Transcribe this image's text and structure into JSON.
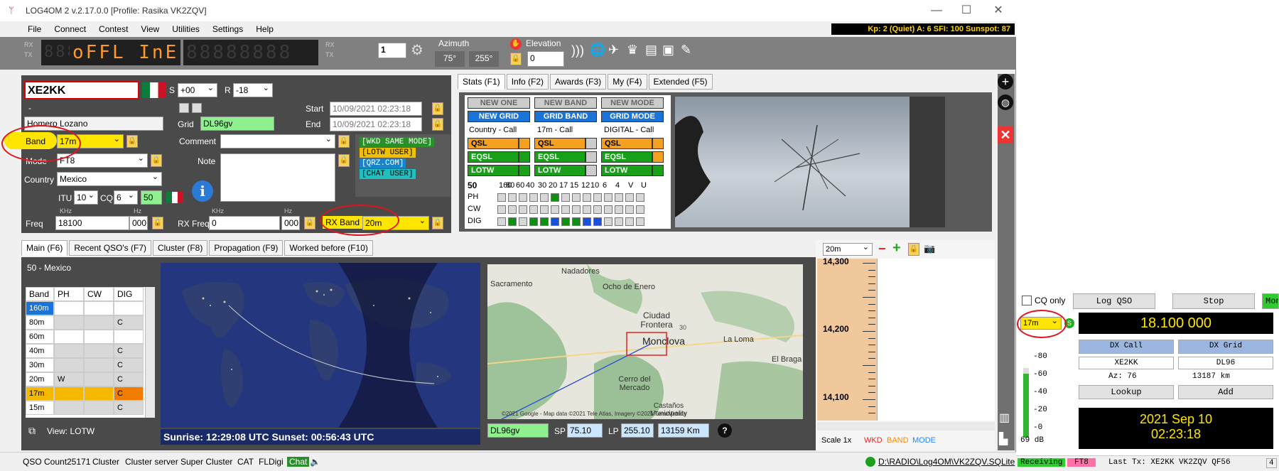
{
  "window": {
    "title": "LOG4OM 2 v.2.17.0.0 [Profile: Rasika VK2ZQV]",
    "minimize": "—",
    "maximize": "☐",
    "close": "✕"
  },
  "menu": [
    "File",
    "Connect",
    "Contest",
    "View",
    "Utilities",
    "Settings",
    "Help"
  ],
  "solar": "Kp: 2 (Quiet)  A: 6  SFI: 100 Sunspot: 87",
  "toolbar": {
    "rx_label": "RX",
    "tx_label": "TX",
    "rx2_label": "RX",
    "tx2_label": "TX",
    "display1": "88888",
    "display_main": "oFFL InE",
    "display2": "88888888",
    "radio_num": "1",
    "azimuth_label": "Azimuth",
    "azimuth_sp": "75°",
    "azimuth_lp": "255°",
    "elevation_label": "Elevation",
    "elevation_value": "0"
  },
  "qso": {
    "callsign": "XE2KK",
    "s_label": "S",
    "s_value": "+00",
    "r_label": "R",
    "r_value": "-18",
    "dash": "-",
    "name": "Homero Lozano",
    "grid_label": "Grid",
    "grid": "DL96gv",
    "start_label": "Start",
    "start": "10/09/2021 02:23:18",
    "end_label": "End",
    "end": "10/09/2021 02:23:18",
    "band_label": "Band",
    "band": "17m",
    "comment_label": "Comment",
    "comment": "",
    "mode_label": "Mode",
    "mode": "FT8",
    "note_label": "Note",
    "country_label": "Country",
    "country": "Mexico",
    "itu_label": "ITU",
    "itu": "10",
    "cq_label": "CQ",
    "cq": "6",
    "dxcc": "50",
    "freq_label": "Freq",
    "khz": "KHz",
    "hz": "Hz",
    "freq_khz": "18100",
    "freq_hz": "000",
    "rxfreq_label": "RX Freq",
    "rxfreq_khz": "0",
    "rxfreq_hz": "000",
    "rxband_label": "RX Band",
    "rxband": "20m",
    "tags": [
      "[WKD SAME MODE]",
      "[LOTW USER]",
      "[QRZ.COM]",
      "[CHAT USER]"
    ]
  },
  "stats": {
    "tabs": [
      "Stats (F1)",
      "Info (F2)",
      "Awards (F3)",
      "My (F4)",
      "Extended (F5)"
    ],
    "row1": [
      "NEW ONE",
      "NEW BAND",
      "NEW MODE"
    ],
    "row2": [
      "NEW GRID",
      "GRID BAND",
      "GRID MODE"
    ],
    "captions": [
      "Country - Call",
      "17m - Call",
      "DIGITAL - Call"
    ],
    "qsl": "QSL",
    "eqsl": "EQSL",
    "lotw": "LOTW",
    "dxcc": "50",
    "bands": [
      "160",
      "80",
      "60",
      "40",
      "30",
      "20",
      "17",
      "15",
      "12",
      "10",
      "6",
      "4",
      "V",
      "U"
    ],
    "modes": [
      "PH",
      "CW",
      "DIG"
    ]
  },
  "main_tabs": [
    "Main (F6)",
    "Recent QSO's (F7)",
    "Cluster (F8)",
    "Propagation (F9)",
    "Worked before (F10)"
  ],
  "band_table": {
    "title": "50 - Mexico",
    "headers": [
      "Band",
      "PH",
      "CW",
      "DIG"
    ],
    "rows": [
      [
        "160m",
        "",
        "",
        ""
      ],
      [
        "80m",
        "",
        "",
        "C"
      ],
      [
        "60m",
        "",
        "",
        ""
      ],
      [
        "40m",
        "",
        "",
        "C"
      ],
      [
        "30m",
        "",
        "",
        "C"
      ],
      [
        "20m",
        "W",
        "",
        "C"
      ],
      [
        "17m",
        "",
        "",
        "C"
      ],
      [
        "15m",
        "",
        "",
        "C"
      ]
    ],
    "view_label": "View:  LOTW"
  },
  "sun": "Sunrise: 12:29:08 UTC  Sunset: 00:56:43 UTC",
  "map": {
    "places": [
      "Nadadores",
      "Sacramento",
      "Ocho de Enero",
      "Ciudad Frontera",
      "Monclova",
      "La Loma",
      "El Braga",
      "Cerro del Mercado",
      "Castaños Municipality"
    ],
    "road": "30",
    "copyright": "©2021 Google - Map data ©2021 Tele Atlas, Imagery ©2021 TerraMetrics",
    "grid": "DL96gv",
    "sp_label": "SP",
    "sp": "75.10",
    "lp_label": "LP",
    "lp": "255.10",
    "distance": "13159 Km"
  },
  "bandmap": {
    "band": "20m",
    "ticks": [
      "14,300",
      "14,200",
      "14,100"
    ],
    "scale": "Scale 1x",
    "wkd": "WKD",
    "band_lbl": "BAND",
    "mode_lbl": "MODE"
  },
  "status": [
    "QSO Count",
    "25171",
    "Cluster",
    "Cluster server",
    "Super Cluster",
    "CAT",
    "FLDigi",
    "Chat"
  ],
  "db_path": "D:\\RADIO\\Log4OM\\VK2ZQV.SQLite",
  "ft8": {
    "cq_only": "CQ only",
    "log_qso": "Log QSO",
    "stop": "Stop",
    "monitor": "Moni",
    "band": "17m",
    "freq": "18.100 000",
    "dx_call_label": "DX Call",
    "dx_grid_label": "DX Grid",
    "dx_call": "XE2KK",
    "dx_grid": "DL96",
    "az": "Az: 76",
    "km": "13187 km",
    "lookup": "Lookup",
    "add": "Add",
    "meter": [
      "-80",
      "-60",
      "-40",
      "-20",
      "-0"
    ],
    "db": "69 dB",
    "date": "2021 Sep 10",
    "time": "02:23:18",
    "receiving": "Receiving",
    "mode": "FT8",
    "last_tx": "Last Tx: XE2KK VK2ZQV QF56",
    "count": "4"
  }
}
